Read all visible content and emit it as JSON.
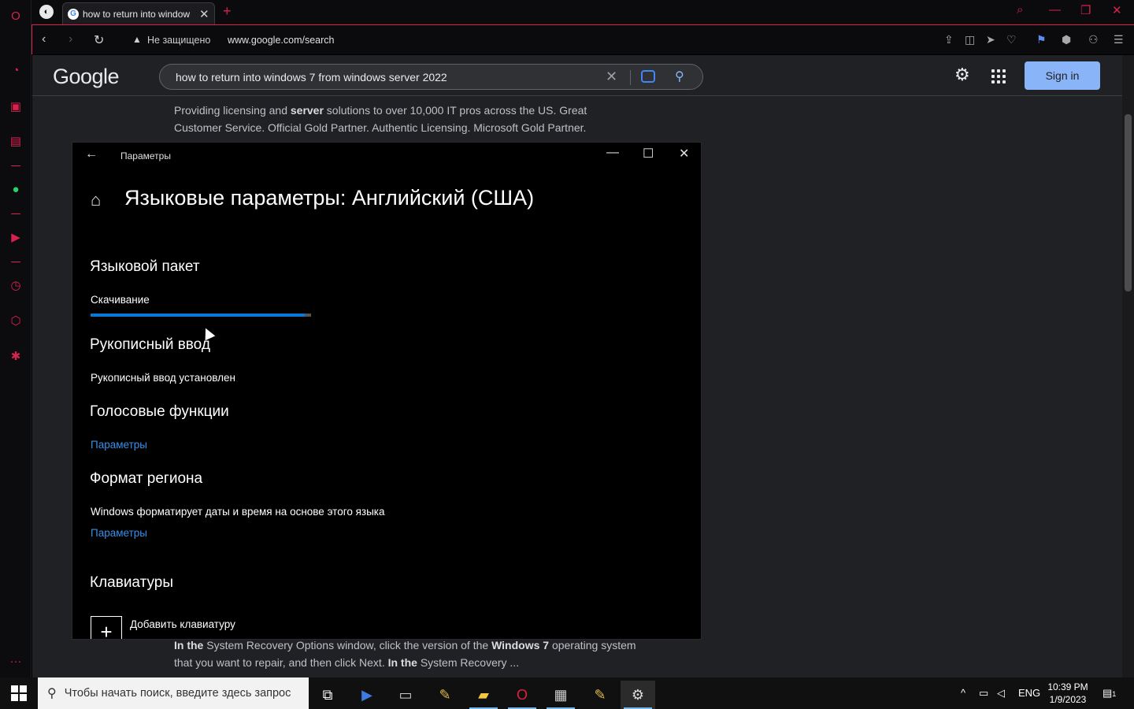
{
  "browser": {
    "tab_title": "how to return into window",
    "security_label": "Не защищено",
    "url": "www.google.com/search"
  },
  "google": {
    "logo": "Google",
    "query": "how to return into windows 7 from windows server 2022",
    "signin_label": "Sign in",
    "snippet_top": {
      "line1_pre": "Providing licensing and ",
      "line1_bold": "server",
      "line1_post": " solutions to over 10,000 IT pros across the US. Great",
      "line2": "Customer Service. Official Gold Partner. Authentic Licensing. Microsoft Gold Partner."
    },
    "snippet_bottom": {
      "line1_b1": "In the",
      "line1_mid": " System Recovery Options window, click the version of the ",
      "line1_b2": "Windows 7",
      "line1_post": " operating system",
      "line2_pre": "that you want to repair, and then click Next. ",
      "line2_bold": "In the",
      "line2_post": " System Recovery ..."
    }
  },
  "settings": {
    "window_title": "Параметры",
    "page_title": "Языковые параметры: Английский (США)",
    "sections": {
      "language_pack": "Языковой пакет",
      "downloading": "Скачивание",
      "download_progress": 0.97,
      "handwriting": "Рукописный ввод",
      "handwriting_status": "Рукописный ввод установлен",
      "speech": "Голосовые функции",
      "speech_link": "Параметры",
      "region": "Формат региона",
      "region_text": "Windows форматирует даты и время на основе этого языка",
      "region_link": "Параметры",
      "keyboards": "Клавиатуры",
      "add_keyboard": "Добавить клавиатуру"
    }
  },
  "taskbar": {
    "search_placeholder": "Чтобы начать поиск, введите здесь запрос",
    "lang": "ENG",
    "time": "10:39 PM",
    "date": "1/9/2023",
    "notifications": "1"
  }
}
